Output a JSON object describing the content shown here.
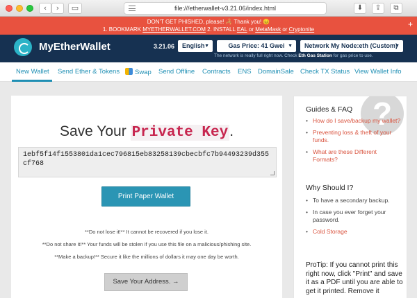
{
  "browser": {
    "url": "file:///etherwallet-v3.21.06/index.html",
    "back_icon": "chevron-left-icon",
    "forward_icon": "chevron-right-icon"
  },
  "warning": {
    "line1": "DON'T GET PHISHED, please! 🦂 Thank you! 😊",
    "line2_prefix": "1. BOOKMARK ",
    "bookmark_link": "MYETHERWALLET.COM",
    "line2_mid": "  2. INSTALL ",
    "eal_link": "EAL",
    "or1": " or ",
    "metamask_link": "MetaMask",
    "or2": " or ",
    "cryptonite_link": "Cryptonite"
  },
  "header": {
    "brand": "MyEtherWallet",
    "version": "3.21.06",
    "language": "English",
    "gas_price": "Gas Price: 41 Gwei",
    "node": "Network My Node:eth (Custom)",
    "note_prefix": "The network is really full right now. Check ",
    "note_link": "Eth Gas Station",
    "note_suffix": " for gas price to use."
  },
  "tabs": [
    {
      "label": "New Wallet"
    },
    {
      "label": "Send Ether & Tokens"
    },
    {
      "label": "Swap"
    },
    {
      "label": "Send Offline"
    },
    {
      "label": "Contracts"
    },
    {
      "label": "ENS"
    },
    {
      "label": "DomainSale"
    },
    {
      "label": "Check TX Status"
    },
    {
      "label": "View Wallet Info"
    }
  ],
  "main": {
    "title_prefix": "Save Your ",
    "title_highlight": "Private Key",
    "title_suffix": ".",
    "private_key": "1ebf5f14f1553801da1cec796815eb83258139cbecbfc7b94493239d355cf768",
    "print_button": "Print Paper Wallet",
    "note1": "**Do not lose it!** It cannot be recovered if you lose it.",
    "note2": "**Do not share it!** Your funds will be stolen if you use this file on a malicious/phishing site.",
    "note3": "**Make a backup!** Secure it like the millions of dollars it may one day be worth.",
    "save_address_button": "Save Your Address. →"
  },
  "sidebar": {
    "qmark": "?",
    "guides_heading": "Guides & FAQ",
    "guides": [
      "How do I save/backup my wallet?",
      "Preventing loss & theft of your funds.",
      "What are these Different Formats?"
    ],
    "why_heading": "Why Should I?",
    "why": [
      "To have a secondary backup.",
      "In case you ever forget your password.",
      "Cold Storage"
    ],
    "protip": "ProTip: If you cannot print this right now, click \"Print\" and save it as a PDF until you are able to get it printed. Remove it"
  }
}
